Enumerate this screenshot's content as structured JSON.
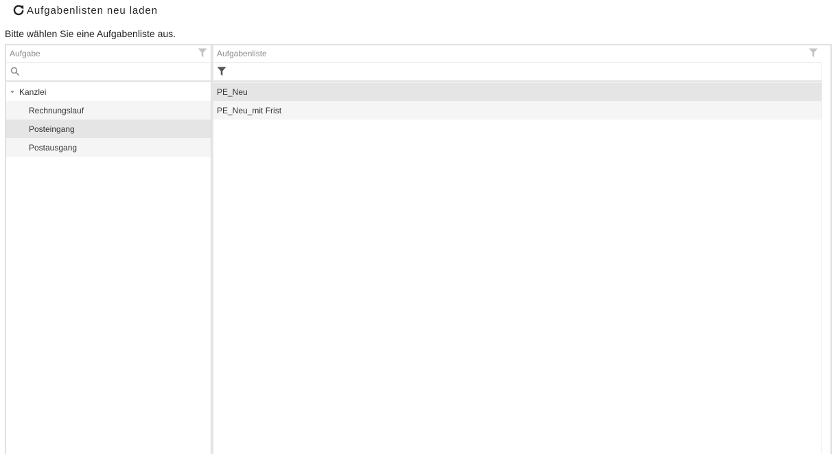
{
  "toolbar": {
    "reload_label": "Aufgabenlisten neu laden",
    "reload_icon": "refresh-icon"
  },
  "instruction": "Bitte wählen Sie eine Aufgabenliste aus.",
  "left_grid": {
    "header": "Aufgabe",
    "search_value": "",
    "search_icon": "search-icon",
    "filter_icon": "funnel-icon",
    "tree": {
      "group_label": "Kanzlei",
      "expanded": true,
      "items": [
        {
          "label": "Rechnungslauf"
        },
        {
          "label": "Posteingang",
          "selected": true
        },
        {
          "label": "Postausgang"
        }
      ]
    }
  },
  "right_grid": {
    "header": "Aufgabenliste",
    "filter_icon": "funnel-icon",
    "rows": [
      {
        "label": "PE_Neu",
        "selected": true
      },
      {
        "label": "PE_Neu_mit Frist"
      }
    ]
  },
  "colors": {
    "selected_row": "#e5e5e5",
    "alt_row": "#f5f5f5",
    "border": "#e0e0e0",
    "header_text": "#8a8a8a"
  }
}
